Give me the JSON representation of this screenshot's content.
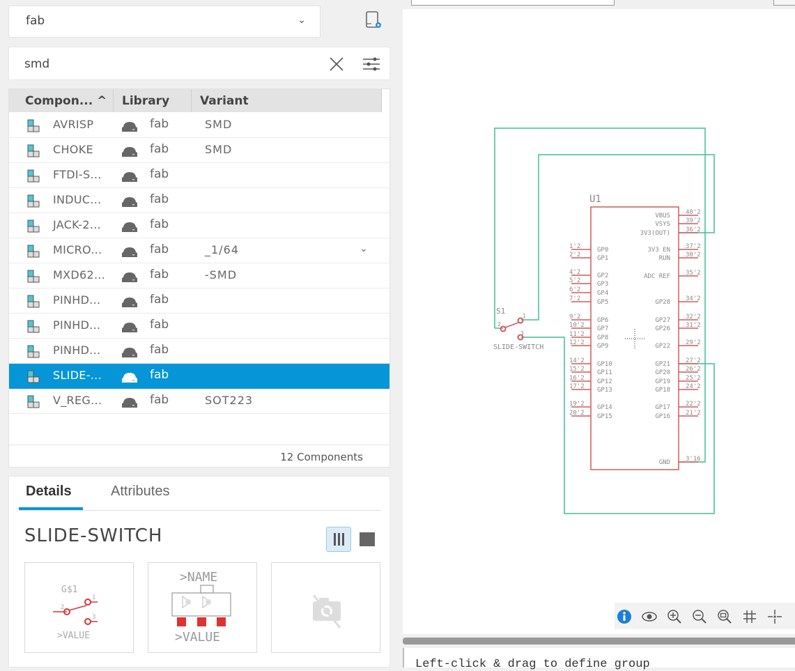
{
  "library_select": {
    "value": "fab"
  },
  "search": {
    "value": "smd",
    "placeholder": ""
  },
  "table": {
    "columns": [
      "Compon... ^",
      "Library",
      "Variant"
    ],
    "rows": [
      {
        "name": "AVRISP",
        "library": "fab",
        "variant": "SMD"
      },
      {
        "name": "CHOKE",
        "library": "fab",
        "variant": "SMD"
      },
      {
        "name": "FTDI-S...",
        "library": "fab",
        "variant": ""
      },
      {
        "name": "INDUC...",
        "library": "fab",
        "variant": ""
      },
      {
        "name": "JACK-2...",
        "library": "fab",
        "variant": ""
      },
      {
        "name": "MICRO...",
        "library": "fab",
        "variant": "_1/64",
        "has_dropdown": true
      },
      {
        "name": "MXD62...",
        "library": "fab",
        "variant": "-SMD"
      },
      {
        "name": "PINHD...",
        "library": "fab",
        "variant": ""
      },
      {
        "name": "PINHD...",
        "library": "fab",
        "variant": ""
      },
      {
        "name": "PINHD...",
        "library": "fab",
        "variant": ""
      },
      {
        "name": "SLIDE-...",
        "library": "fab",
        "variant": "",
        "selected": true
      },
      {
        "name": "V_REG...",
        "library": "fab",
        "variant": "SOT223"
      }
    ],
    "footer": "12 Components"
  },
  "details": {
    "tabs": [
      "Details",
      "Attributes"
    ],
    "active_tab": "Details",
    "component_title": "SLIDE-SWITCH",
    "symbol_preview": {
      "name": "G$1",
      "value": ">VALUE",
      "pins": [
        "1",
        "2",
        "3"
      ]
    },
    "footprint_preview": {
      "name": ">NAME",
      "value": ">VALUE"
    },
    "model_preview": "no-3d-model-icon"
  },
  "schematic": {
    "part_name": "U1",
    "switch_name": "S1",
    "switch_value": "SLIDE-SWITCH",
    "switch_pins": [
      "1",
      "2",
      "3"
    ],
    "left_pins": [
      {
        "num": "1'2",
        "label": "GP0"
      },
      {
        "num": "2'2",
        "label": "GP1"
      },
      {
        "num": "4'2",
        "label": "GP2"
      },
      {
        "num": "5'2",
        "label": "GP3"
      },
      {
        "num": "6'2",
        "label": "GP4"
      },
      {
        "num": "7'2",
        "label": "GP5"
      },
      {
        "num": "9'2",
        "label": "GP6"
      },
      {
        "num": "10'2",
        "label": "GP7"
      },
      {
        "num": "11'2",
        "label": "GP8"
      },
      {
        "num": "12'2",
        "label": "GP9"
      },
      {
        "num": "14'2",
        "label": "GP10"
      },
      {
        "num": "15'2",
        "label": "GP11"
      },
      {
        "num": "16'2",
        "label": "GP12"
      },
      {
        "num": "17'2",
        "label": "GP13"
      },
      {
        "num": "19'2",
        "label": "GP14"
      },
      {
        "num": "20'2",
        "label": "GP15"
      }
    ],
    "right_pins": [
      {
        "num": "40'2",
        "label": "VBUS"
      },
      {
        "num": "39'2",
        "label": "VSYS"
      },
      {
        "num": "36'2",
        "label": "3V3(OUT)"
      },
      {
        "num": "37'2",
        "label": "3V3 EN"
      },
      {
        "num": "30'2",
        "label": "RUN"
      },
      {
        "num": "35'2",
        "label": "ADC REF"
      },
      {
        "num": "34'2",
        "label": "GP28"
      },
      {
        "num": "32'2",
        "label": "GP27"
      },
      {
        "num": "31'2",
        "label": "GP26"
      },
      {
        "num": "29'2",
        "label": "GP22"
      },
      {
        "num": "27'2",
        "label": "GP21"
      },
      {
        "num": "26'2",
        "label": "GP20"
      },
      {
        "num": "25'2",
        "label": "GP19"
      },
      {
        "num": "24'2",
        "label": "GP18"
      },
      {
        "num": "22'2",
        "label": "GP17"
      },
      {
        "num": "21'2",
        "label": "GP16"
      },
      {
        "num": "3'16",
        "label": "GND"
      }
    ],
    "colors": {
      "part": "#d05a5a",
      "wire": "#3fbf94",
      "text": "#888888"
    }
  },
  "zoombar": {
    "icons": [
      "info-icon",
      "eye-icon",
      "zoom-in-icon",
      "zoom-out-icon",
      "zoom-fit-icon",
      "grid-icon",
      "crosshair-icon"
    ]
  },
  "console": {
    "message": "Left-click & drag to define group"
  },
  "colors": {
    "accent": "#0696d7",
    "selection": "#0696d7"
  }
}
